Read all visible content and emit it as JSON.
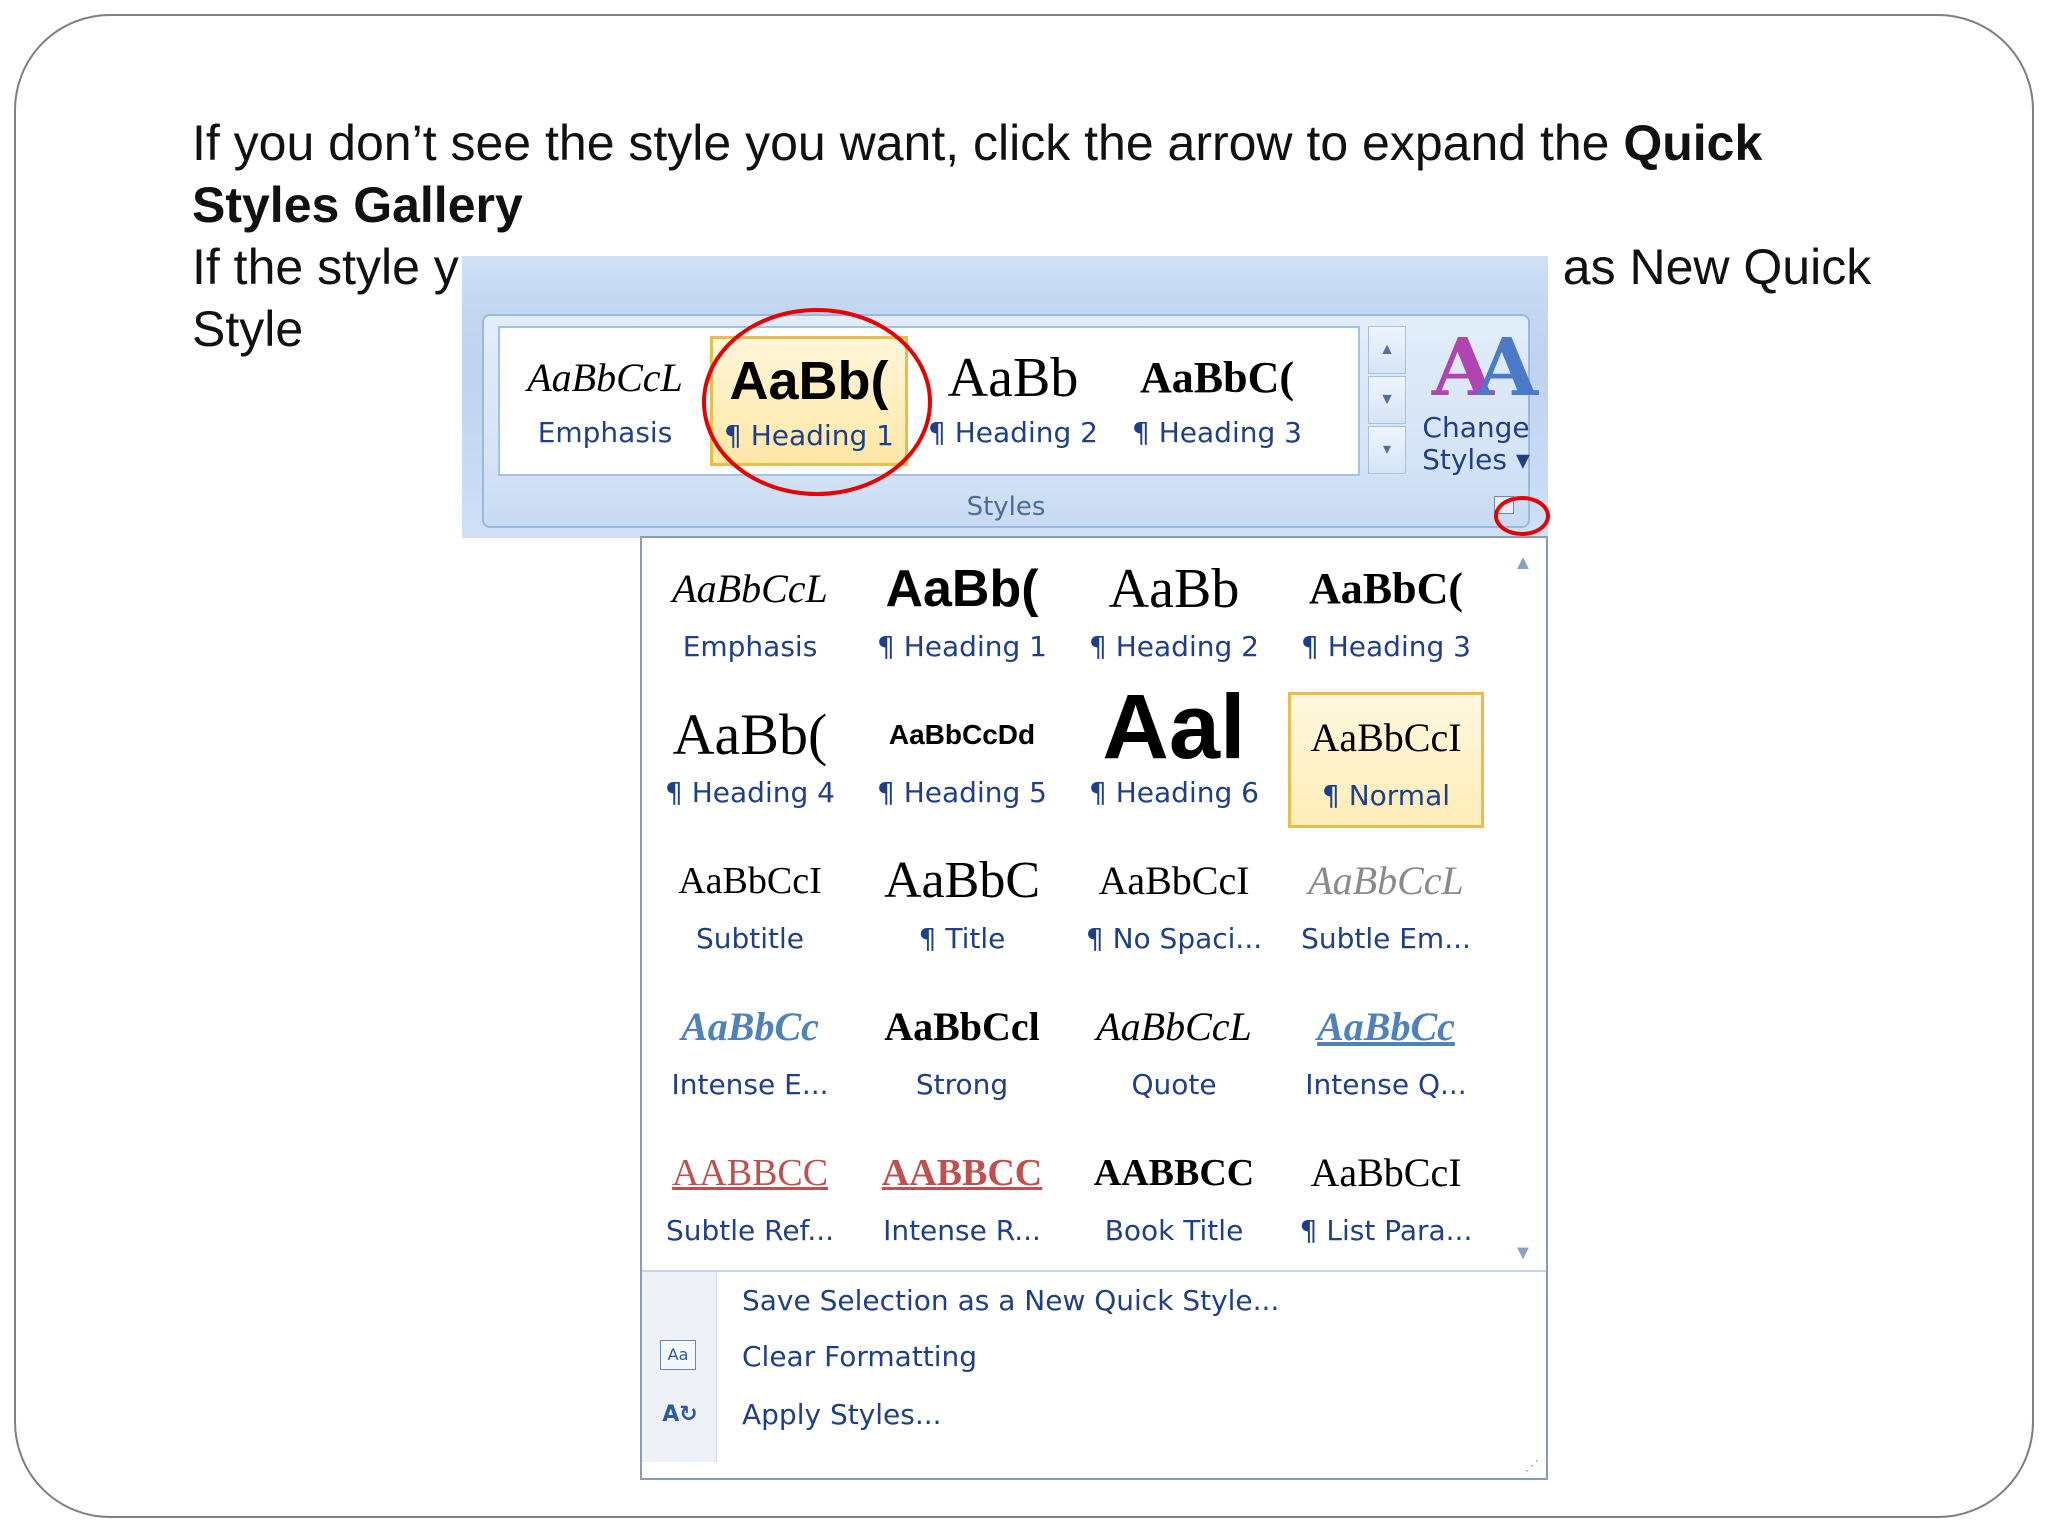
{
  "slide": {
    "line1_normal": "If you don’t see the style you want, click the arrow to expand the ",
    "line1_bold": "Quick Styles Gallery",
    "line2_start": "If the style y",
    "line2_end": "as New Quick",
    "line3": "Style"
  },
  "ribbon": {
    "tiles": [
      {
        "sample": "AaBbCcL",
        "name": "Emphasis"
      },
      {
        "sample": "AaBb(",
        "name": "¶ Heading 1"
      },
      {
        "sample": "AaBb",
        "name": "¶ Heading 2"
      },
      {
        "sample": "AaBbC(",
        "name": "¶ Heading 3"
      }
    ],
    "change_styles_line1": "Change",
    "change_styles_line2": "Styles ▾",
    "group_label": "Styles",
    "scroll_up": "▲",
    "scroll_down": "▼",
    "scroll_more": "▾"
  },
  "gallery": {
    "tiles": [
      {
        "sample": "AaBbCcL",
        "name": "Emphasis"
      },
      {
        "sample": "AaBb(",
        "name": "¶ Heading 1"
      },
      {
        "sample": "AaBb",
        "name": "¶ Heading 2"
      },
      {
        "sample": "AaBbC(",
        "name": "¶ Heading 3"
      },
      {
        "sample": "AaBb(",
        "name": "¶ Heading 4"
      },
      {
        "sample": "AaBbCcDd",
        "name": "¶ Heading 5"
      },
      {
        "sample": "Aal",
        "name": "¶ Heading 6"
      },
      {
        "sample": "AaBbCcI",
        "name": "¶ Normal"
      },
      {
        "sample": "AaBbCcI",
        "name": "Subtitle"
      },
      {
        "sample": "AaBbC",
        "name": "¶ Title"
      },
      {
        "sample": "AaBbCcI",
        "name": "¶ No Spaci..."
      },
      {
        "sample": "AaBbCcL",
        "name": "Subtle Em..."
      },
      {
        "sample": "AaBbCc",
        "name": "Intense E..."
      },
      {
        "sample": "AaBbCcl",
        "name": "Strong"
      },
      {
        "sample": "AaBbCcL",
        "name": "Quote"
      },
      {
        "sample": "AaBbCc",
        "name": "Intense Q..."
      },
      {
        "sample": "AABBCC",
        "name": "Subtle Ref..."
      },
      {
        "sample": "AABBCC",
        "name": "Intense R..."
      },
      {
        "sample": "AABBCC",
        "name": "Book Title"
      },
      {
        "sample": "AaBbCcI",
        "name": "¶ List Para..."
      }
    ],
    "menu": [
      {
        "label": "Save Selection as a New Quick Style...",
        "icon": "save-style-icon"
      },
      {
        "label": "Clear Formatting",
        "icon": "clear-formatting-icon"
      },
      {
        "label": "Apply Styles...",
        "icon": "apply-styles-icon"
      }
    ],
    "scroll_up": "▲",
    "scroll_down": "▼"
  },
  "colors": {
    "label_blue": "#1f3f88",
    "highlight_circle": "#e60000",
    "selected_border": "#e9bd4b",
    "ribbon_blue": "#c9daf2"
  }
}
